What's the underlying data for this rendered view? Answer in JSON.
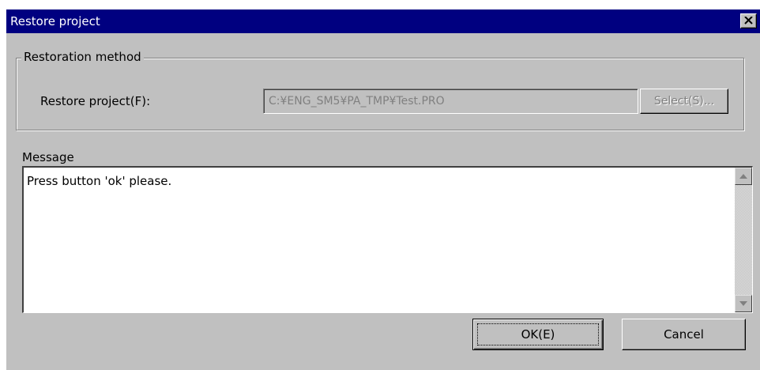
{
  "window": {
    "title": "Restore project",
    "close_icon": "close-icon",
    "titlebar_color": "#000080",
    "face_color": "#c0c0c0"
  },
  "restoration": {
    "group_title": "Restoration method",
    "project_label": "Restore project(F):",
    "project_path": "C:¥ENG_SM5¥PA_TMP¥Test.PRO",
    "select_button": "Select(S)..."
  },
  "message": {
    "label": "Message",
    "text": "Press button 'ok' please."
  },
  "buttons": {
    "ok": "OK(E)",
    "cancel": "Cancel"
  }
}
